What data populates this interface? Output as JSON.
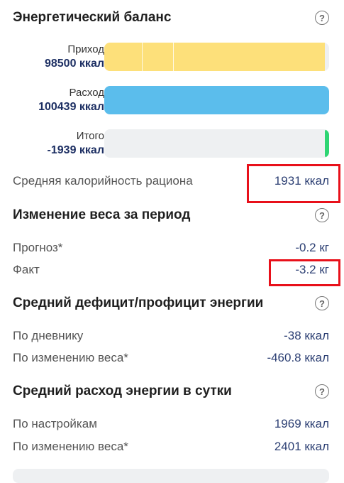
{
  "energy_balance": {
    "title": "Энергетический баланс",
    "bars": [
      {
        "label": "Приход",
        "value": "98500 ккал",
        "fill": 0.98,
        "color": "#fde07a"
      },
      {
        "label": "Расход",
        "value": "100439 ккал",
        "fill": 1.0,
        "color": "#5bbdec"
      },
      {
        "label": "Итого",
        "value": "-1939 ккал",
        "fill": 0.02,
        "color": "#2ed573"
      }
    ],
    "avg_calorie_label": "Средняя калорийность рациона",
    "avg_calorie_value": "1931 ккал"
  },
  "weight_change": {
    "title": "Изменение веса за период",
    "forecast_label": "Прогноз*",
    "forecast_value": "-0.2 кг",
    "fact_label": "Факт",
    "fact_value": "-3.2 кг"
  },
  "avg_deficit": {
    "title": "Средний дефицит/профицит энергии",
    "diary_label": "По дневнику",
    "diary_value": "-38 ккал",
    "weight_label": "По изменению веса*",
    "weight_value": "-460.8 ккал"
  },
  "avg_expenditure": {
    "title": "Средний расход энергии в сутки",
    "settings_label": "По настройкам",
    "settings_value": "1969 ккал",
    "weight_label": "По изменению веса*",
    "weight_value": "2401 ккал"
  },
  "help_symbol": "?"
}
